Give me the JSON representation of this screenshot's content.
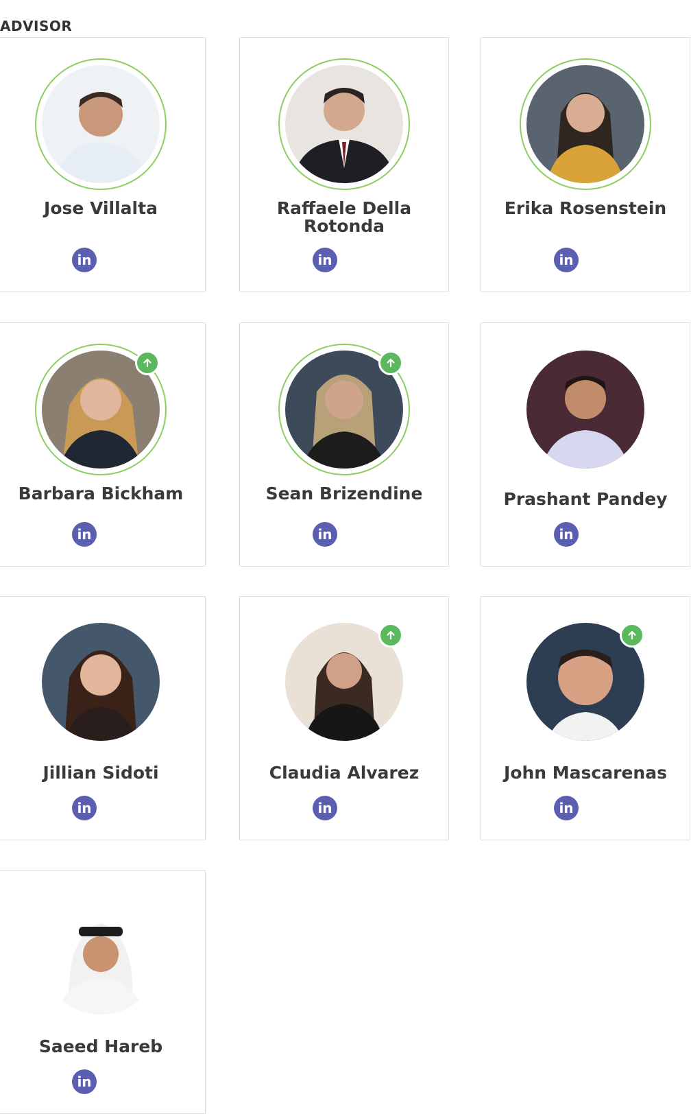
{
  "section": {
    "title": "ADVISOR"
  },
  "advisors": [
    {
      "name": "Jose Villalta",
      "linkedin_label": "in",
      "photo_icon": "person-photo-icon"
    },
    {
      "name": "Raffaele Della Rotonda",
      "linkedin_label": "in",
      "photo_icon": "person-photo-icon"
    },
    {
      "name": "Erika Rosenstein",
      "linkedin_label": "in",
      "photo_icon": "person-photo-icon"
    },
    {
      "name": "Barbara Bickham",
      "linkedin_label": "in",
      "photo_icon": "person-photo-icon",
      "badge_icon": "arrow-up-icon"
    },
    {
      "name": "Sean Brizendine",
      "linkedin_label": "in",
      "photo_icon": "person-photo-icon",
      "badge_icon": "arrow-up-icon"
    },
    {
      "name": "Prashant Pandey",
      "linkedin_label": "in",
      "photo_icon": "person-photo-icon"
    },
    {
      "name": "Jillian Sidoti",
      "linkedin_label": "in",
      "photo_icon": "person-photo-icon"
    },
    {
      "name": "Claudia Alvarez",
      "linkedin_label": "in",
      "photo_icon": "person-photo-icon",
      "badge_icon": "arrow-up-icon"
    },
    {
      "name": "John Mascarenas",
      "linkedin_label": "in",
      "photo_icon": "person-photo-icon",
      "badge_icon": "arrow-up-icon"
    },
    {
      "name": "Saeed Hareb",
      "linkedin_label": "in",
      "photo_icon": "person-photo-icon"
    }
  ],
  "colors": {
    "ring": "#8ccf5f",
    "badge": "#5cb85c",
    "linkedin": "#5b5fb0",
    "card_border": "#dcdcdc",
    "text": "#3a3a3a"
  }
}
